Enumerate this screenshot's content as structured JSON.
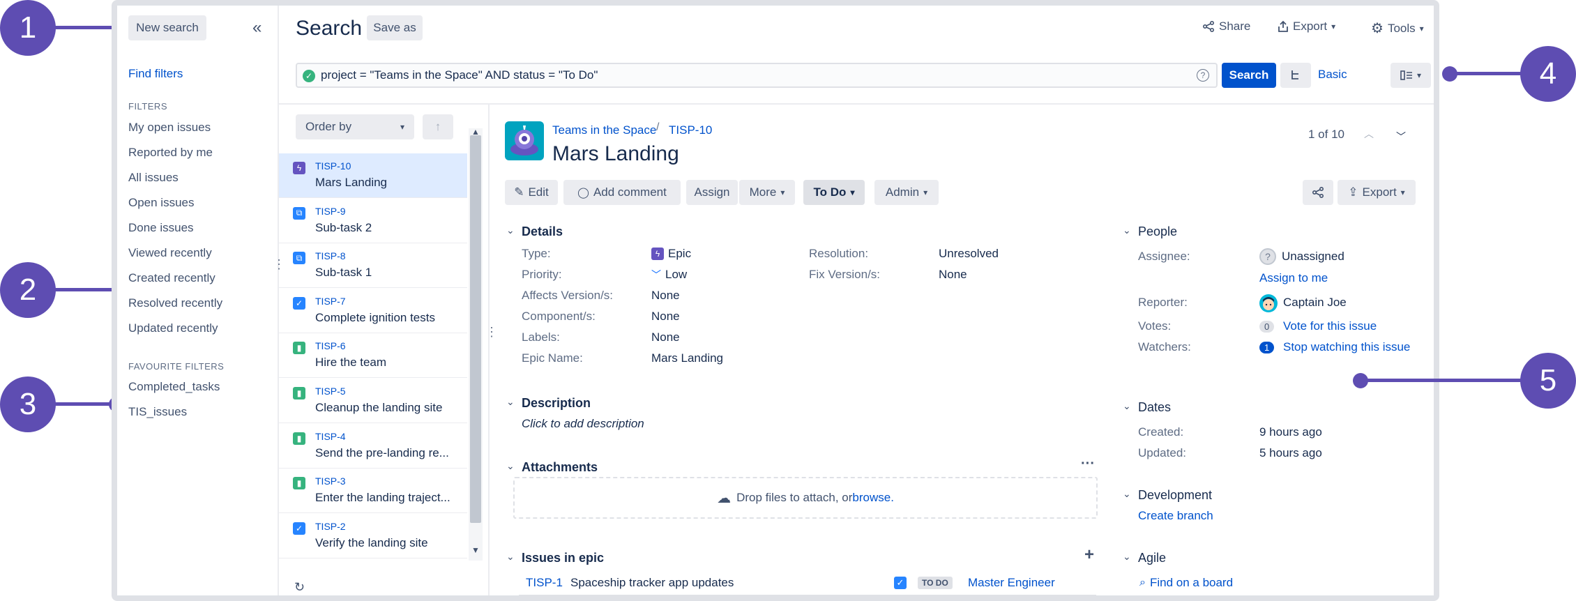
{
  "callouts": [
    "1",
    "2",
    "3",
    "4",
    "5"
  ],
  "sidebar": {
    "new_search": "New search",
    "collapse": "«",
    "find_filters": "Find filters",
    "filters_heading": "FILTERS",
    "filters": [
      "My open issues",
      "Reported by me",
      "All issues",
      "Open issues",
      "Done issues",
      "Viewed recently",
      "Created recently",
      "Resolved recently",
      "Updated recently"
    ],
    "favourites_heading": "FAVOURITE FILTERS",
    "favourites": [
      "Completed_tasks",
      "TIS_issues"
    ]
  },
  "header": {
    "title": "Search",
    "save_as": "Save as",
    "share": "Share",
    "export": "Export",
    "tools": "Tools"
  },
  "query": {
    "text": "project = \"Teams in the Space\" AND status = \"To Do\"",
    "search_button": "Search",
    "basic": "Basic"
  },
  "list": {
    "order_by": "Order by",
    "issues": [
      {
        "key": "TISP-10",
        "summary": "Mars Landing",
        "type": "epic"
      },
      {
        "key": "TISP-9",
        "summary": "Sub-task 2",
        "type": "subtask"
      },
      {
        "key": "TISP-8",
        "summary": "Sub-task 1",
        "type": "subtask"
      },
      {
        "key": "TISP-7",
        "summary": "Complete ignition tests",
        "type": "task"
      },
      {
        "key": "TISP-6",
        "summary": "Hire the team",
        "type": "story"
      },
      {
        "key": "TISP-5",
        "summary": "Cleanup the landing site",
        "type": "story"
      },
      {
        "key": "TISP-4",
        "summary": "Send the pre-landing re...",
        "type": "story"
      },
      {
        "key": "TISP-3",
        "summary": "Enter the landing traject...",
        "type": "story"
      },
      {
        "key": "TISP-2",
        "summary": "Verify the landing site",
        "type": "task"
      }
    ]
  },
  "issue": {
    "project": "Teams in the Space",
    "separator": "/",
    "key": "TISP-10",
    "title": "Mars Landing",
    "pager": "1 of 10",
    "actions": {
      "edit": "Edit",
      "add_comment": "Add comment",
      "assign": "Assign",
      "more": "More",
      "status": "To Do",
      "admin": "Admin",
      "export": "Export"
    },
    "details_title": "Details",
    "details_left": [
      {
        "label": "Type:",
        "value": "Epic"
      },
      {
        "label": "Priority:",
        "value": "Low"
      },
      {
        "label": "Affects Version/s:",
        "value": "None"
      },
      {
        "label": "Component/s:",
        "value": "None"
      },
      {
        "label": "Labels:",
        "value": "None"
      },
      {
        "label": "Epic Name:",
        "value": "Mars Landing"
      }
    ],
    "details_right": [
      {
        "label": "Resolution:",
        "value": "Unresolved"
      },
      {
        "label": "Fix Version/s:",
        "value": "None"
      }
    ],
    "description_title": "Description",
    "description_placeholder": "Click to add description",
    "attachments_title": "Attachments",
    "attach_text": "Drop files to attach, or ",
    "attach_link": "browse.",
    "epic_issues_title": "Issues in epic",
    "epic_issue": {
      "key": "TISP-1",
      "summary": "Spaceship tracker app updates",
      "status": "TO DO",
      "assignee": "Master Engineer"
    }
  },
  "people": {
    "title": "People",
    "assignee_label": "Assignee:",
    "assignee": "Unassigned",
    "assign_to_me": "Assign to me",
    "reporter_label": "Reporter:",
    "reporter": "Captain Joe",
    "votes_label": "Votes:",
    "votes_count": "0",
    "vote_link": "Vote for this issue",
    "watchers_label": "Watchers:",
    "watchers_count": "1",
    "watch_link": "Stop watching this issue"
  },
  "dates": {
    "title": "Dates",
    "created_label": "Created:",
    "created": "9 hours ago",
    "updated_label": "Updated:",
    "updated": "5 hours ago"
  },
  "development": {
    "title": "Development",
    "create_branch": "Create branch"
  },
  "agile": {
    "title": "Agile",
    "find_board": "Find on a board"
  },
  "colors": {
    "accent": "#0052cc",
    "callout": "#5e4db2",
    "epic": "#6554c0",
    "story": "#36b37e",
    "task": "#2684ff"
  }
}
